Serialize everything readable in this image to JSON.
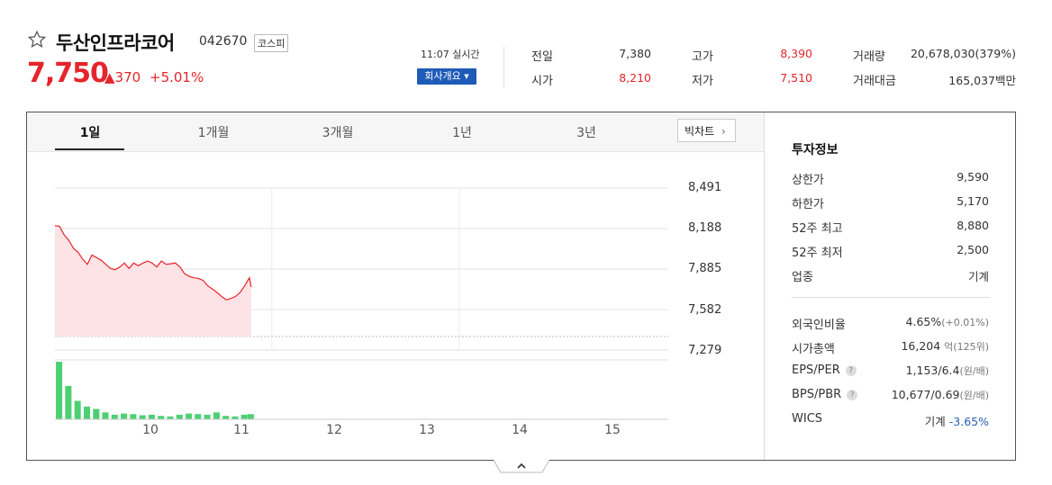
{
  "stock": {
    "name": "두산인프라코어",
    "code": "042670",
    "market": "코스피",
    "price": "7,750",
    "change": "▲370",
    "change_pct": "+5.01%",
    "time": "11:07 실시간",
    "overview_button": "회사개요",
    "colors": {
      "up": "#e5242b",
      "down": "#2a5fb8",
      "accent": "#1e5bb8"
    }
  },
  "quotes": [
    {
      "label": "전일",
      "value": "7,380",
      "color": "normal"
    },
    {
      "label": "고가",
      "value": "8,390",
      "color": "up"
    },
    {
      "label": "거래량",
      "value": "20,678,030(379%)",
      "color": "normal"
    },
    {
      "label": "시가",
      "value": "8,210",
      "color": "up"
    },
    {
      "label": "저가",
      "value": "7,510",
      "color": "up"
    },
    {
      "label": "거래대금",
      "value": "165,037백만",
      "color": "normal"
    }
  ],
  "tabs": [
    "1일",
    "1개월",
    "3개월",
    "1년",
    "3년"
  ],
  "active_tab": "1일",
  "big_chart_button": "빅차트",
  "chart_data": {
    "type": "area",
    "y_ticks": [
      "8,491",
      "8,188",
      "7,885",
      "7,582",
      "7,279"
    ],
    "ylim": [
      7279,
      8491
    ],
    "x_ticks": [
      "10",
      "11",
      "12",
      "13",
      "14",
      "15"
    ],
    "previous_close": 7380,
    "price_series": {
      "x": [
        9.0,
        9.05,
        9.1,
        9.15,
        9.2,
        9.25,
        9.3,
        9.35,
        9.4,
        9.45,
        9.5,
        9.55,
        9.6,
        9.65,
        9.7,
        9.75,
        9.8,
        9.85,
        9.9,
        9.95,
        10.0,
        10.05,
        10.1,
        10.15,
        10.2,
        10.25,
        10.3,
        10.35,
        10.4,
        10.45,
        10.5,
        10.55,
        10.6,
        10.65,
        10.7,
        10.75,
        10.8,
        10.85,
        10.9,
        10.95,
        11.0,
        11.05,
        11.1,
        11.12
      ],
      "y": [
        8210,
        8205,
        8140,
        8100,
        8040,
        8010,
        7960,
        7920,
        7990,
        7970,
        7950,
        7920,
        7890,
        7880,
        7900,
        7930,
        7890,
        7930,
        7910,
        7930,
        7945,
        7930,
        7900,
        7945,
        7920,
        7925,
        7930,
        7900,
        7850,
        7830,
        7820,
        7815,
        7800,
        7760,
        7735,
        7710,
        7680,
        7655,
        7665,
        7680,
        7710,
        7760,
        7820,
        7750
      ]
    },
    "volume_series": {
      "x": [
        9.05,
        9.15,
        9.25,
        9.35,
        9.45,
        9.55,
        9.65,
        9.75,
        9.85,
        9.95,
        10.05,
        10.15,
        10.25,
        10.35,
        10.45,
        10.55,
        10.65,
        10.75,
        10.85,
        10.95,
        11.05,
        11.12
      ],
      "values": [
        100,
        58,
        32,
        22,
        18,
        12,
        8,
        10,
        9,
        7,
        8,
        6,
        5,
        8,
        10,
        9,
        8,
        12,
        6,
        5,
        8,
        9
      ]
    }
  },
  "invest_info": {
    "title": "투자정보",
    "rows1": [
      {
        "label": "상한가",
        "value": "9,590",
        "color": "up"
      },
      {
        "label": "하한가",
        "value": "5,170",
        "color": "down"
      },
      {
        "label": "52주 최고",
        "value": "8,880",
        "color": "normal"
      },
      {
        "label": "52주 최저",
        "value": "2,500",
        "color": "normal"
      },
      {
        "label": "업종",
        "value": "기계",
        "color": "normal"
      }
    ],
    "rows2": [
      {
        "label": "외국인비율",
        "value": "4.65%",
        "sub": "(+0.01%)",
        "help": false
      },
      {
        "label": "시가총액",
        "value": "16,204",
        "sub": "억(125위)",
        "help": false
      },
      {
        "label": "EPS/PER",
        "value": "1,153/6.4",
        "sub": "(원/배)",
        "help": true
      },
      {
        "label": "BPS/PBR",
        "value": "10,677/0.69",
        "sub": "(원/배)",
        "help": true
      },
      {
        "label": "WICS",
        "value": "기계",
        "sub": "-3.65%",
        "help": false
      }
    ]
  }
}
